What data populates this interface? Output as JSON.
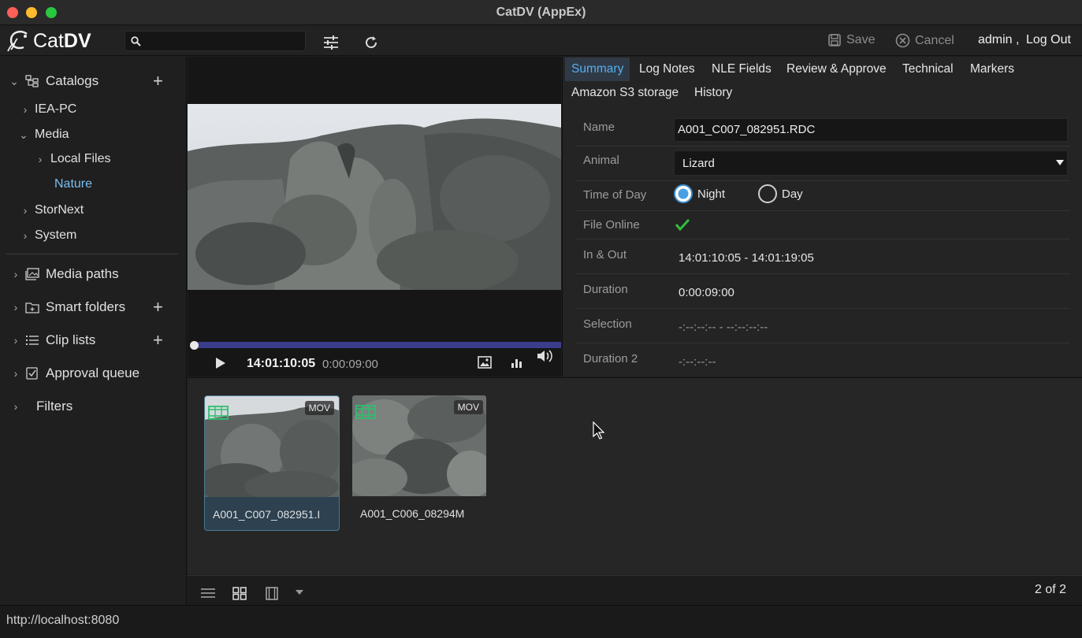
{
  "window": {
    "title": "CatDV (AppEx)"
  },
  "toolbar": {
    "logo_cat": "Cat",
    "logo_dv": "DV",
    "search_placeholder": "",
    "save_label": "Save",
    "cancel_label": "Cancel",
    "user": "admin ,",
    "logout_label": "Log Out"
  },
  "sidebar": {
    "catalogs_label": "Catalogs",
    "tree": {
      "iea_pc": "IEA-PC",
      "media": "Media",
      "local_files": "Local Files",
      "nature": "Nature",
      "stornext": "StorNext",
      "system": "System"
    },
    "media_paths": "Media paths",
    "smart_folders": "Smart folders",
    "clip_lists": "Clip lists",
    "approval_queue": "Approval queue",
    "filters": "Filters"
  },
  "player": {
    "timecode": "14:01:10:05",
    "duration": "0:00:09:00",
    "playhead_fraction": 0.0
  },
  "tabs": [
    "Summary",
    "Log Notes",
    "NLE Fields",
    "Review & Approve",
    "Technical",
    "Markers",
    "Amazon S3 storage",
    "History"
  ],
  "fields": {
    "name_label": "Name",
    "name_value": "A001_C007_082951.RDC",
    "animal_label": "Animal",
    "animal_value": "Lizard",
    "time_of_day_label": "Time of Day",
    "night_label": "Night",
    "day_label": "Day",
    "time_of_day_selected": "Night",
    "file_online_label": "File Online",
    "in_out_label": "In & Out",
    "in_out_value": "14:01:10:05 - 14:01:19:05",
    "duration_label": "Duration",
    "duration_value": "0:00:09:00",
    "selection_label": "Selection",
    "selection_value": "-:--:--:-- - --:--:--:--",
    "duration2_label": "Duration 2",
    "duration2_value": "-:--:--:--"
  },
  "clips": [
    {
      "name": "A001_C007_082951.I",
      "badge": "MOV"
    },
    {
      "name": "A001_C006_08294M",
      "badge": "MOV"
    }
  ],
  "pagination": "2 of 2",
  "status": {
    "url": "http://localhost:8080"
  },
  "colors": {
    "accent": "#57aef1",
    "check": "#2fbf3f",
    "progress": "#3a3d8c"
  }
}
